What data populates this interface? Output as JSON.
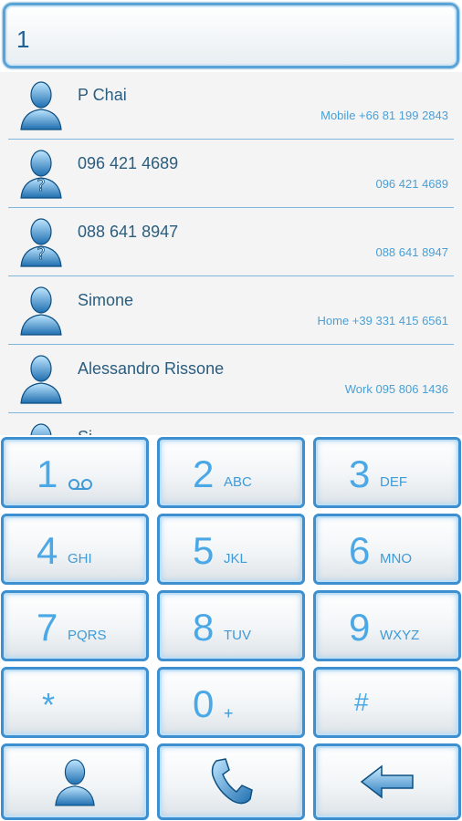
{
  "dialer": {
    "input_value": "1"
  },
  "contacts": [
    {
      "name": "P Chai",
      "detail": "Mobile +66 81 199 2843",
      "avatar": "contact-silhouette-icon"
    },
    {
      "name": "096 421 4689",
      "detail": "096 421 4689",
      "avatar": "unknown-contact-icon"
    },
    {
      "name": "088 641 8947",
      "detail": "088 641 8947",
      "avatar": "unknown-contact-icon"
    },
    {
      "name": "Simone",
      "detail": "Home +39 331 415 6561",
      "avatar": "contact-silhouette-icon"
    },
    {
      "name": "Alessandro Rissone",
      "detail": "Work 095 806 1436",
      "avatar": "contact-silhouette-icon"
    },
    {
      "name": "Si...",
      "detail": "",
      "avatar": "contact-silhouette-icon"
    }
  ],
  "keys": {
    "k1": {
      "digit": "1",
      "icon": "voicemail-icon"
    },
    "k2": {
      "digit": "2",
      "letters": "ABC"
    },
    "k3": {
      "digit": "3",
      "letters": "DEF"
    },
    "k4": {
      "digit": "4",
      "letters": "GHI"
    },
    "k5": {
      "digit": "5",
      "letters": "JKL"
    },
    "k6": {
      "digit": "6",
      "letters": "MNO"
    },
    "k7": {
      "digit": "7",
      "letters": "PQRS"
    },
    "k8": {
      "digit": "8",
      "letters": "TUV"
    },
    "k9": {
      "digit": "9",
      "letters": "WXYZ"
    },
    "kstar": {
      "digit": "*"
    },
    "k0": {
      "digit": "0",
      "letters": "+"
    },
    "khash": {
      "digit": "#"
    }
  },
  "bottom_bar": {
    "contacts_icon": "contacts-icon",
    "call_icon": "phone-call-icon",
    "backspace_icon": "backspace-arrow-icon"
  },
  "colors": {
    "accent": "#3d8fcf",
    "text_blue": "#4aa8e6",
    "name_text": "#2a5d7e"
  }
}
